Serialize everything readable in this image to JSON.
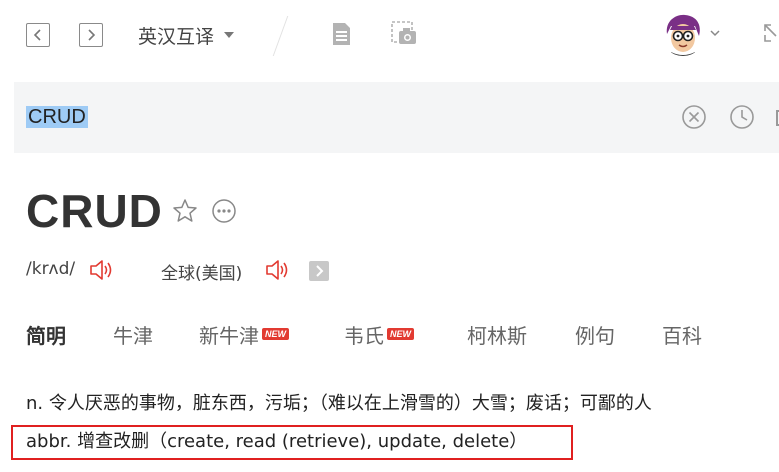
{
  "toolbar": {
    "back_label": "<",
    "forward_label": ">",
    "mode": "英汉互译",
    "icons": [
      "document-icon",
      "screenshot-icon"
    ],
    "avatar": "user-avatar"
  },
  "search": {
    "value": "CRUD"
  },
  "entry": {
    "headword": "CRUD",
    "phonetic": "/krʌd/",
    "region": "全球(美国)"
  },
  "tabs": [
    {
      "label": "简明",
      "active": true,
      "badge": ""
    },
    {
      "label": "牛津",
      "active": false,
      "badge": ""
    },
    {
      "label": "新牛津",
      "active": false,
      "badge": "NEW"
    },
    {
      "label": "韦氏",
      "active": false,
      "badge": "NEW"
    },
    {
      "label": "柯林斯",
      "active": false,
      "badge": ""
    },
    {
      "label": "例句",
      "active": false,
      "badge": ""
    },
    {
      "label": "百科",
      "active": false,
      "badge": ""
    }
  ],
  "definitions": [
    "n. 令人厌恶的事物，脏东西，污垢；（难以在上滑雪的）大雪；废话；可鄙的人",
    "abbr. 增查改删（create, read (retrieve), update, delete）"
  ],
  "colors": {
    "accent": "#e02020",
    "badge": "#e23a31",
    "selection": "#9ecbf5"
  }
}
